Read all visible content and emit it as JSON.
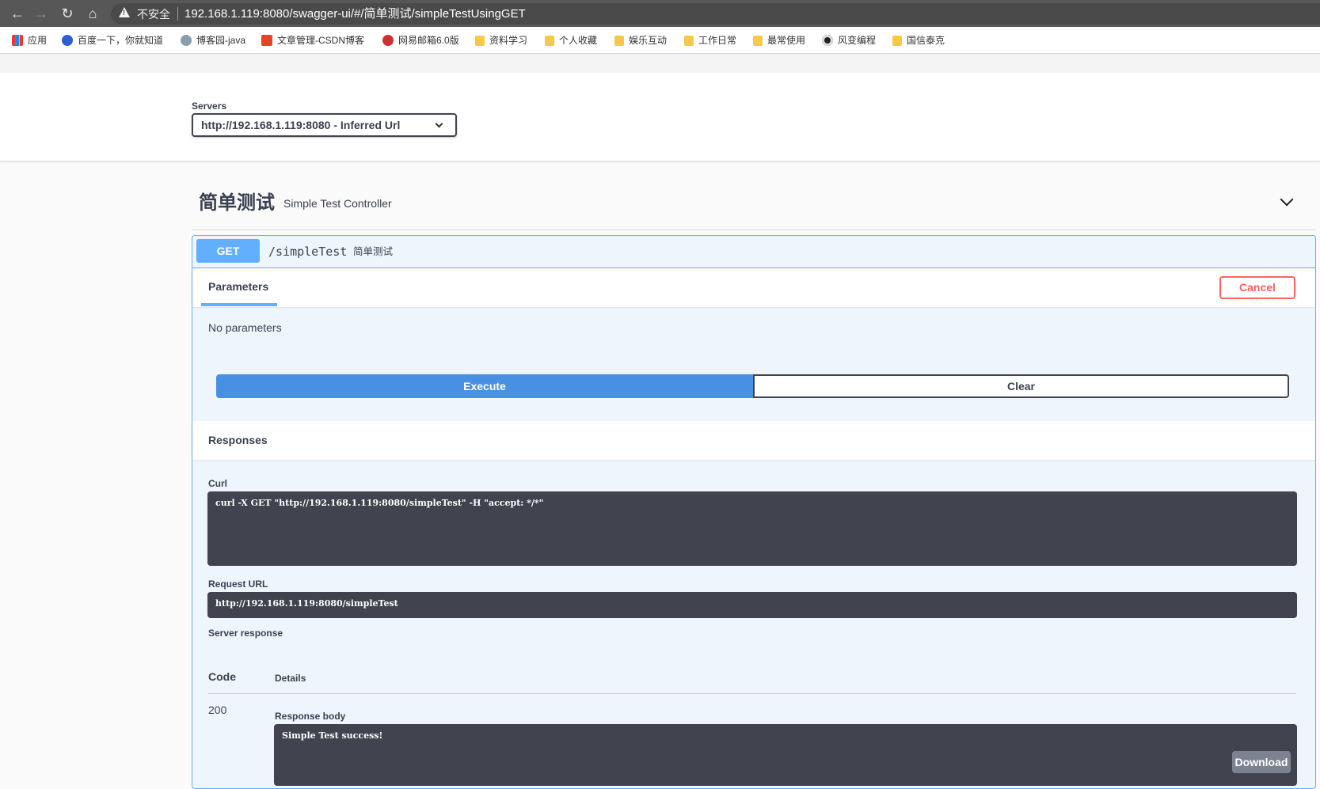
{
  "browser": {
    "insecure_label": "不安全",
    "url": "192.168.1.119:8080/swagger-ui/#/简单测试/simpleTestUsingGET",
    "bookmarks": [
      {
        "label": "应用",
        "icon": "apps-icon"
      },
      {
        "label": "百度一下，你就知道",
        "icon": "baidu-icon"
      },
      {
        "label": "博客园-java",
        "icon": "cnblogs-icon"
      },
      {
        "label": "文章管理-CSDN博客",
        "icon": "csdn-icon"
      },
      {
        "label": "网易邮箱6.0版",
        "icon": "mail-icon"
      },
      {
        "label": "资料学习",
        "icon": "folder-icon"
      },
      {
        "label": "个人收藏",
        "icon": "folder-icon"
      },
      {
        "label": "娱乐互动",
        "icon": "folder-icon"
      },
      {
        "label": "工作日常",
        "icon": "folder-icon"
      },
      {
        "label": "最常使用",
        "icon": "folder-icon"
      },
      {
        "label": "风变编程",
        "icon": "panda-icon"
      },
      {
        "label": "国信泰克",
        "icon": "folder-icon"
      }
    ]
  },
  "servers": {
    "label": "Servers",
    "selected": "http://192.168.1.119:8080 - Inferred Url"
  },
  "tag": {
    "name": "简单测试",
    "description": "Simple Test Controller"
  },
  "operation": {
    "method": "GET",
    "path": "/simpleTest",
    "summary": "简单测试",
    "parameters_tab": "Parameters",
    "cancel_label": "Cancel",
    "no_parameters": "No parameters",
    "execute_label": "Execute",
    "clear_label": "Clear"
  },
  "responses": {
    "title": "Responses",
    "curl_label": "Curl",
    "curl_command": "curl -X GET \"http://192.168.1.119:8080/simpleTest\" -H \"accept: */*\"",
    "request_url_label": "Request URL",
    "request_url": "http://192.168.1.119:8080/simpleTest",
    "server_response_label": "Server response",
    "code_header": "Code",
    "details_header": "Details",
    "status_code": "200",
    "response_body_label": "Response body",
    "response_body": "Simple Test success!",
    "download_label": "Download"
  },
  "colors": {
    "get_method": "#61affe",
    "execute": "#4990e2",
    "cancel": "#ff6060",
    "code_bg": "#41444e"
  }
}
